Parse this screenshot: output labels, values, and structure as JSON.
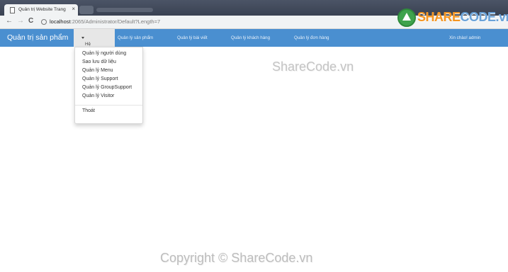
{
  "browser": {
    "tab_title": "Quản trị Website Trang",
    "tab_close": "×",
    "back": "←",
    "forward": "→",
    "reload": "C",
    "url_host": "localhost",
    "url_path": ":2065/Administrator/Default?Length=7"
  },
  "watermark": {
    "logo_share": "SHARE",
    "logo_code": "CODE.vn",
    "center_text": "ShareCode.vn",
    "footer_text": "Copyright © ShareCode.vn"
  },
  "navbar": {
    "brand": "Quản trị sản phẩm",
    "active_item": "Hệ thống",
    "items": [
      "Quản lý sản phẩm",
      "Quản lý bài viết",
      "Quản lý khách hàng",
      "Quản lý đơn hàng"
    ],
    "greeting": "Xin chào! admin"
  },
  "dropdown": {
    "items": [
      "Quản lý người dùng",
      "Sao lưu dữ liệu",
      "Quản lý Menu",
      "Quản lý Support",
      "Quản lý GroupSupport",
      "Quản lý Visitor"
    ],
    "logout": "Thoát"
  },
  "colors": {
    "navbar": "#4a8fd0",
    "active_item_bg": "#e7e7e7"
  }
}
